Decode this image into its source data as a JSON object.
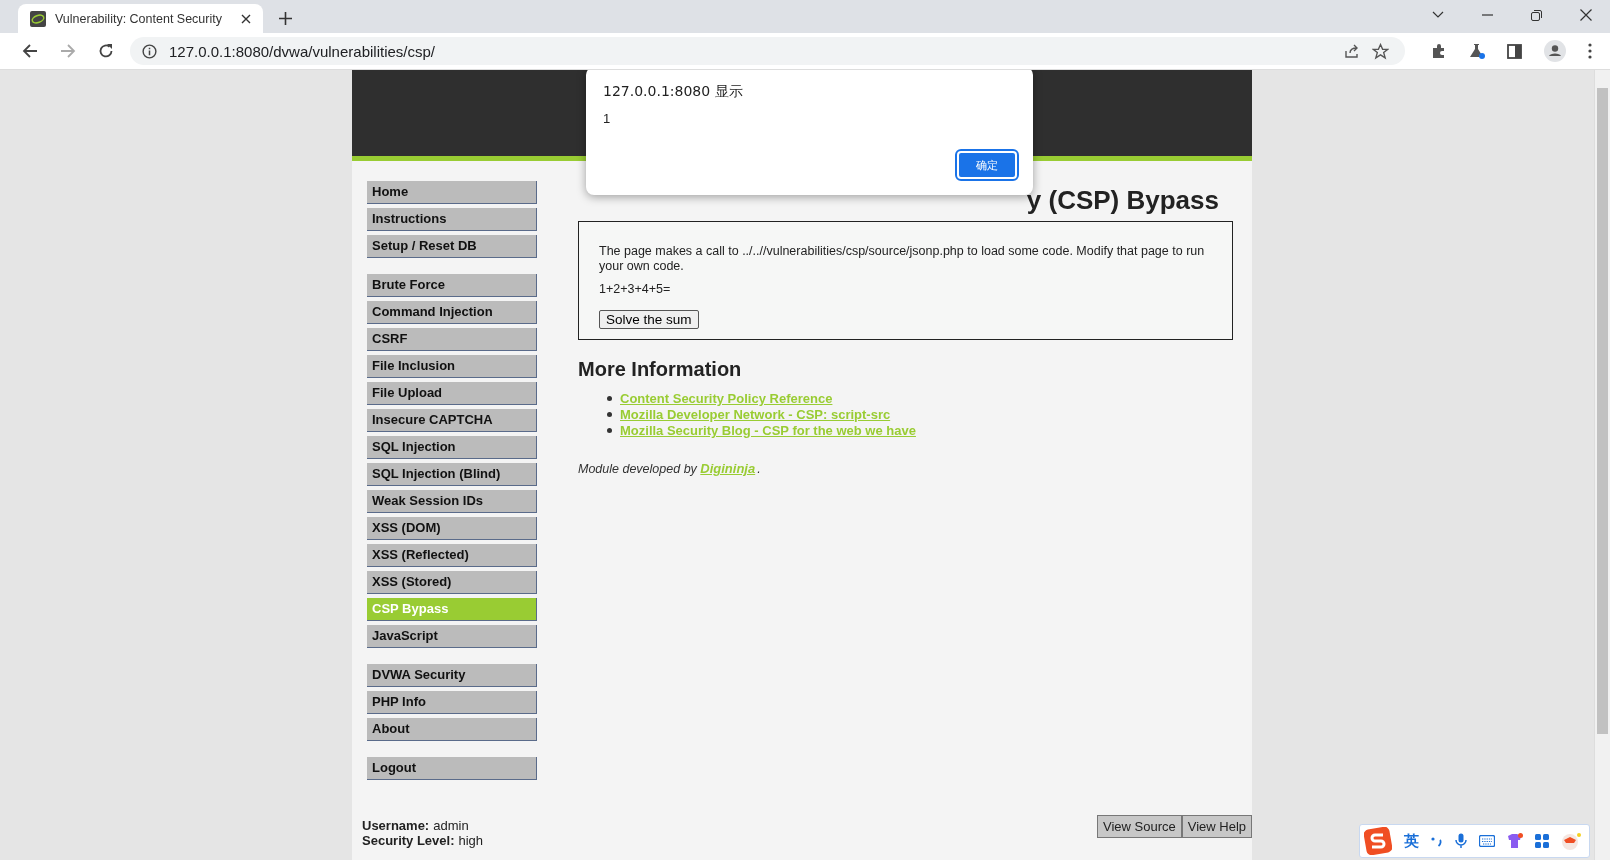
{
  "browser": {
    "tab_title": "Vulnerability: Content Security",
    "address": "127.0.0.1:8080/dvwa/vulnerabilities/csp/"
  },
  "menu_groups": [
    [
      {
        "label": "Home",
        "selected": false
      },
      {
        "label": "Instructions",
        "selected": false
      },
      {
        "label": "Setup / Reset DB",
        "selected": false
      }
    ],
    [
      {
        "label": "Brute Force",
        "selected": false
      },
      {
        "label": "Command Injection",
        "selected": false
      },
      {
        "label": "CSRF",
        "selected": false
      },
      {
        "label": "File Inclusion",
        "selected": false
      },
      {
        "label": "File Upload",
        "selected": false
      },
      {
        "label": "Insecure CAPTCHA",
        "selected": false
      },
      {
        "label": "SQL Injection",
        "selected": false
      },
      {
        "label": "SQL Injection (Blind)",
        "selected": false
      },
      {
        "label": "Weak Session IDs",
        "selected": false
      },
      {
        "label": "XSS (DOM)",
        "selected": false
      },
      {
        "label": "XSS (Reflected)",
        "selected": false
      },
      {
        "label": "XSS (Stored)",
        "selected": false
      },
      {
        "label": "CSP Bypass",
        "selected": true
      },
      {
        "label": "JavaScript",
        "selected": false
      }
    ],
    [
      {
        "label": "DVWA Security",
        "selected": false
      },
      {
        "label": "PHP Info",
        "selected": false
      },
      {
        "label": "About",
        "selected": false
      }
    ],
    [
      {
        "label": "Logout",
        "selected": false
      }
    ]
  ],
  "heading_visible": "y (CSP) Bypass",
  "box": {
    "description": "The page makes a call to ../..//vulnerabilities/csp/source/jsonp.php to load some code. Modify that page to run your own code.",
    "sum": "1+2+3+4+5=",
    "button": "Solve the sum"
  },
  "more_info": {
    "title": "More Information",
    "links": [
      "Content Security Policy Reference",
      "Mozilla Developer Network - CSP: script-src",
      "Mozilla Security Blog - CSP for the web we have"
    ]
  },
  "credit": {
    "prefix": "Module developed by ",
    "link": "Digininja",
    "suffix": "."
  },
  "footer": {
    "fields": [
      {
        "label": "Username:",
        "value": "admin"
      },
      {
        "label": "Security Level:",
        "value": "high"
      }
    ],
    "buttons": [
      "View Source",
      "View Help"
    ]
  },
  "dialog": {
    "title": "127.0.0.1:8080 显示",
    "message": "1",
    "ok": "确定"
  },
  "ime_toolbar": {
    "mode": "英"
  }
}
